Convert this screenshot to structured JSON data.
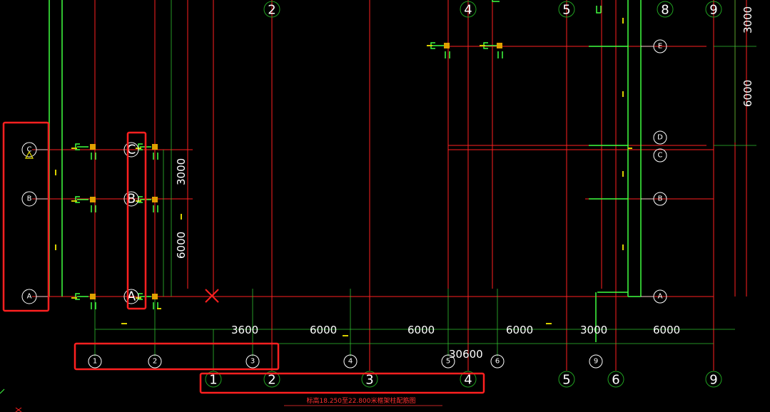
{
  "colors": {
    "background": "#000000",
    "grid_line": "#ff2020",
    "frame_line": "#40ff40",
    "dim_line": "#30c030",
    "bubble_stroke": "#ffffff",
    "top_bubble_stroke": "#20a020",
    "column_fill": "#e0a000",
    "highlight_box": "#ff2020",
    "marker": "#ff2020",
    "warning": "#e8e000"
  },
  "left_axes": [
    "C",
    "B",
    "A"
  ],
  "mid_axes": [
    "C",
    "B",
    "A"
  ],
  "right_axes": [
    "E",
    "D",
    "C",
    "B",
    "A"
  ],
  "top_axes": [
    "2",
    "4",
    "5",
    "8",
    "9"
  ],
  "bottom_axes_upper": [
    "1",
    "2",
    "3",
    "4",
    "5",
    "6",
    "9"
  ],
  "bottom_axes_lower": [
    "1",
    "2",
    "3",
    "4",
    "5",
    "6",
    "9"
  ],
  "dims_horizontal": [
    "3600",
    "6000",
    "6000",
    "6000",
    "3000",
    "6000"
  ],
  "dim_total": "30600",
  "dims_vertical_left": [
    "3000",
    "6000"
  ],
  "dims_vertical_right": [
    "3000",
    "6000"
  ],
  "caption": "标高18.250至22.800米框架柱配筋图",
  "icons": {
    "warning": "warning-triangle-icon",
    "marker": "cross-marker-icon"
  }
}
